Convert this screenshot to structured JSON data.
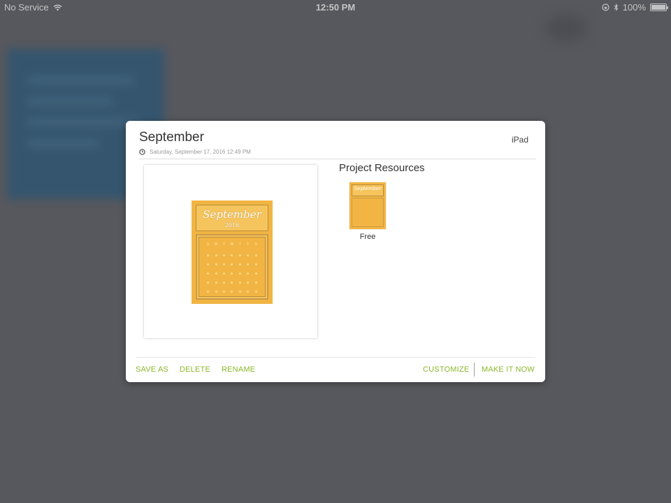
{
  "status_bar": {
    "carrier": "No Service",
    "time": "12:50 PM",
    "battery": "100%",
    "battery_level": 1.0
  },
  "modal": {
    "title": "September",
    "device": "iPad",
    "date": "Saturday, September 17, 2016 12:49 PM",
    "preview": {
      "month": "September",
      "year": "2016",
      "weekdays": [
        "S",
        "M",
        "T",
        "W",
        "T",
        "F",
        "S"
      ]
    },
    "resources": {
      "title": "Project Resources",
      "items": [
        {
          "label": "Free",
          "thumb_month": "September"
        }
      ]
    },
    "actions": {
      "save_as": "SAVE AS",
      "delete": "DELETE",
      "rename": "RENAME",
      "customize": "CUSTOMIZE",
      "make_it_now": "MAKE IT NOW"
    }
  },
  "colors": {
    "accent": "#8ab82b",
    "calendar": "#f2b543",
    "overlay": "#5a5b60"
  },
  "icons": {
    "wifi": "wifi-icon",
    "orientation_lock": "orientation-lock-icon",
    "bluetooth": "bluetooth-icon",
    "battery": "battery-icon",
    "clock": "clock-icon"
  }
}
